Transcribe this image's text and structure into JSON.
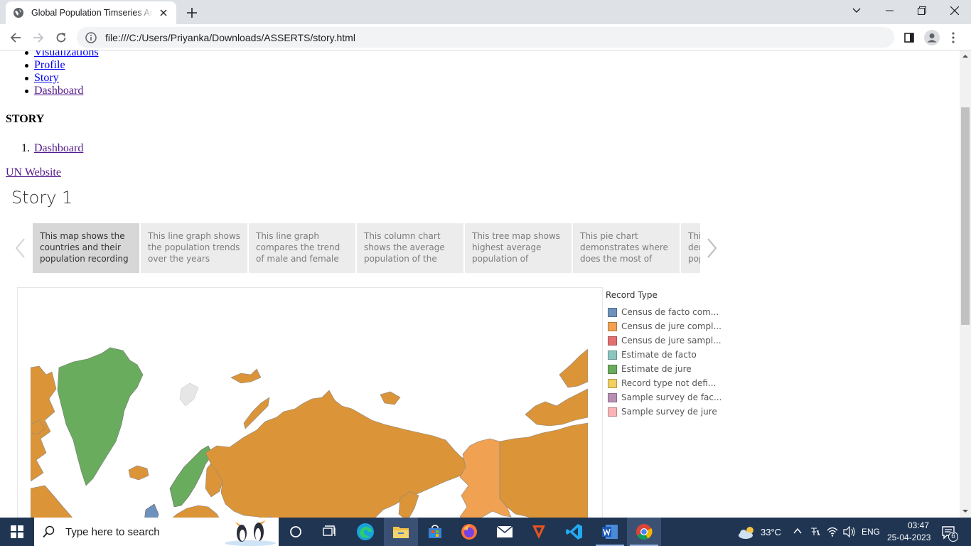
{
  "browser": {
    "tab_title": "Global Population Timseries Analysis",
    "url": "file:///C:/Users/Priyanka/Downloads/ASSERTS/story.html"
  },
  "page": {
    "nav_links": [
      "Visualizations",
      "Profile",
      "Story",
      "Dashboard"
    ],
    "story_heading": "STORY",
    "ordered_list": [
      {
        "number": "1.",
        "label": "Dashboard"
      }
    ],
    "un_link": "UN Website"
  },
  "story": {
    "title": "Story 1",
    "points": [
      "This map shows the countries and their population recording",
      "This line graph shows the population trends over the years",
      "This line graph compares the trend of male and female",
      "This column chart shows the average population of the",
      "This tree map shows highest  average population of",
      "This pie chart demonstrates where does the most of",
      "This chart demonstrates population"
    ],
    "active_point": 0
  },
  "legend": {
    "title": "Record Type",
    "items": [
      {
        "label": "Census de facto com...",
        "color": "#6e92bb"
      },
      {
        "label": "Census de jure compl...",
        "color": "#f0a152"
      },
      {
        "label": "Census de jure sampl...",
        "color": "#e36f6f"
      },
      {
        "label": "Estimate de facto",
        "color": "#8cc5be"
      },
      {
        "label": "Estimate de jure",
        "color": "#6aac5d"
      },
      {
        "label": "Record type not defi...",
        "color": "#f1cf63"
      },
      {
        "label": "Sample survey de fac...",
        "color": "#b88fb2"
      },
      {
        "label": "Sample survey de jure",
        "color": "#fbb3b6"
      }
    ]
  },
  "map_colors": {
    "greenland": "#6aac5d",
    "russia": "#db9438",
    "alaska": "#f0a152",
    "canada": "#db9438",
    "scandinavia": "#6aac5d",
    "central_asia": "#8cc5be",
    "uk": "#6e92bb"
  },
  "taskbar": {
    "search_placeholder": "Type here to search",
    "weather": "33°C",
    "language": "ENG",
    "time": "03:47",
    "date": "25-04-2023",
    "notification_count": "6"
  }
}
